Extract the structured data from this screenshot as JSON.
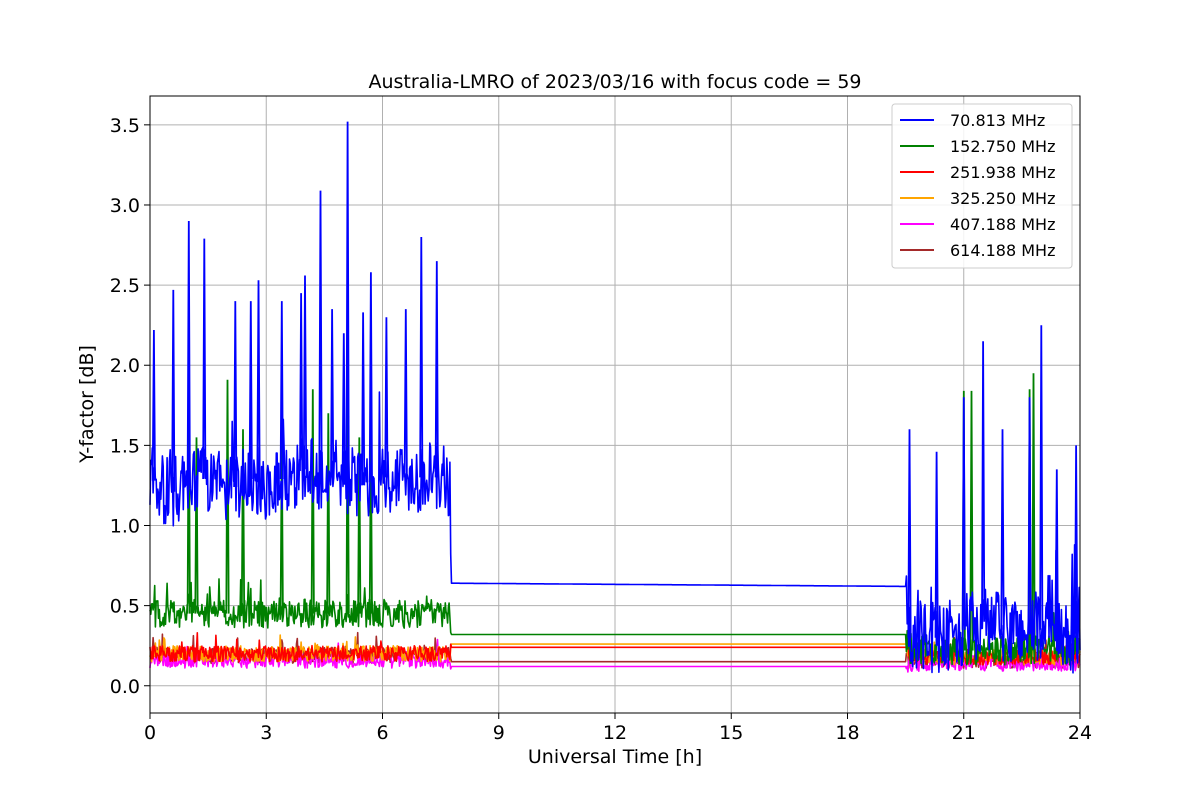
{
  "chart_data": {
    "type": "line",
    "title": "Australia-LMRO of 2023/03/16 with focus code = 59",
    "xlabel": "Universal Time [h]",
    "ylabel": "Y-factor [dB]",
    "xlim": [
      0,
      24
    ],
    "ylim": [
      -0.17,
      3.68
    ],
    "xticks": [
      0,
      3,
      6,
      9,
      12,
      15,
      18,
      21,
      24
    ],
    "yticks": [
      0.0,
      0.5,
      1.0,
      1.5,
      2.0,
      2.5,
      3.0,
      3.5
    ],
    "xtick_labels": [
      "0",
      "3",
      "6",
      "9",
      "12",
      "15",
      "18",
      "21",
      "24"
    ],
    "ytick_labels": [
      "0.0",
      "0.5",
      "1.0",
      "1.5",
      "2.0",
      "2.5",
      "3.0",
      "3.5"
    ],
    "grid": true,
    "legend": "top-right",
    "series": [
      {
        "name": " 70.813 MHz",
        "color": "#0000ff",
        "x": [
          0,
          0.5,
          1.0,
          1.5,
          2.0,
          2.5,
          3.0,
          3.5,
          4.0,
          4.5,
          5.0,
          5.5,
          6.0,
          6.5,
          7.0,
          7.5,
          7.75,
          7.76,
          19.5,
          19.6,
          20.0,
          20.5,
          21.0,
          21.5,
          22.0,
          22.5,
          23.0,
          23.5,
          24.0
        ],
        "y": [
          1.3,
          1.2,
          1.25,
          1.3,
          1.2,
          1.3,
          1.25,
          1.3,
          1.35,
          1.3,
          1.3,
          1.25,
          1.3,
          1.3,
          1.3,
          1.3,
          1.25,
          0.64,
          0.62,
          0.3,
          0.3,
          0.3,
          0.35,
          0.4,
          0.35,
          0.35,
          0.35,
          0.3,
          0.3
        ],
        "peaks": [
          [
            0.1,
            2.22
          ],
          [
            0.6,
            2.47
          ],
          [
            1.0,
            2.9
          ],
          [
            1.4,
            2.79
          ],
          [
            2.2,
            2.4
          ],
          [
            2.6,
            2.4
          ],
          [
            2.8,
            2.53
          ],
          [
            3.4,
            2.4
          ],
          [
            3.9,
            2.45
          ],
          [
            4.0,
            2.56
          ],
          [
            4.4,
            3.09
          ],
          [
            4.7,
            2.35
          ],
          [
            5.0,
            2.2
          ],
          [
            5.1,
            3.52
          ],
          [
            5.5,
            2.33
          ],
          [
            5.7,
            2.58
          ],
          [
            6.1,
            2.3
          ],
          [
            6.6,
            2.35
          ],
          [
            7.0,
            2.8
          ],
          [
            7.4,
            2.65
          ],
          [
            19.6,
            1.6
          ],
          [
            20.3,
            1.46
          ],
          [
            21.0,
            1.8
          ],
          [
            21.5,
            2.15
          ],
          [
            22.0,
            1.6
          ],
          [
            22.7,
            1.8
          ],
          [
            23.0,
            2.25
          ],
          [
            23.4,
            1.35
          ],
          [
            23.9,
            1.5
          ]
        ],
        "noise": 0.22
      },
      {
        "name": "152.750 MHz",
        "color": "#008000",
        "x": [
          0,
          1,
          2,
          3,
          4,
          5,
          6,
          7,
          7.75,
          7.76,
          19.5,
          19.6,
          20.5,
          21.5,
          22.5,
          23.5,
          24.0
        ],
        "y": [
          0.45,
          0.45,
          0.45,
          0.45,
          0.45,
          0.45,
          0.45,
          0.45,
          0.45,
          0.32,
          0.32,
          0.22,
          0.22,
          0.22,
          0.22,
          0.22,
          0.22
        ],
        "peaks": [
          [
            1.0,
            1.94
          ],
          [
            1.2,
            1.55
          ],
          [
            2.0,
            1.91
          ],
          [
            2.4,
            1.6
          ],
          [
            3.4,
            1.55
          ],
          [
            4.2,
            1.85
          ],
          [
            4.6,
            1.7
          ],
          [
            5.1,
            1.95
          ],
          [
            5.4,
            1.55
          ],
          [
            5.7,
            1.55
          ],
          [
            21.0,
            1.84
          ],
          [
            21.2,
            1.84
          ],
          [
            22.7,
            1.85
          ],
          [
            22.8,
            1.95
          ]
        ],
        "noise": 0.09
      },
      {
        "name": "251.938 MHz",
        "color": "#ff0000",
        "x": [
          0,
          2,
          4,
          6,
          7.75,
          7.76,
          19.5,
          19.6,
          21,
          22.5,
          24.0
        ],
        "y": [
          0.2,
          0.2,
          0.2,
          0.2,
          0.2,
          0.24,
          0.24,
          0.18,
          0.18,
          0.18,
          0.18
        ],
        "peaks": [],
        "noise": 0.05
      },
      {
        "name": "325.250 MHz",
        "color": "#ffa500",
        "x": [
          0,
          2,
          4,
          6,
          7.75,
          7.76,
          19.5,
          19.6,
          21,
          22.5,
          24.0
        ],
        "y": [
          0.2,
          0.2,
          0.2,
          0.2,
          0.2,
          0.26,
          0.26,
          0.18,
          0.18,
          0.18,
          0.18
        ],
        "peaks": [],
        "noise": 0.05
      },
      {
        "name": "407.188 MHz",
        "color": "#ff00ff",
        "x": [
          0,
          2,
          4,
          6,
          7.75,
          7.76,
          19.5,
          19.6,
          21,
          22.5,
          24.0
        ],
        "y": [
          0.16,
          0.16,
          0.16,
          0.16,
          0.16,
          0.12,
          0.12,
          0.14,
          0.14,
          0.14,
          0.14
        ],
        "peaks": [],
        "noise": 0.05
      },
      {
        "name": "614.188 MHz",
        "color": "#a52a2a",
        "x": [
          0,
          2,
          4,
          6,
          7.75,
          7.76,
          19.5,
          19.6,
          21,
          22.5,
          24.0
        ],
        "y": [
          0.19,
          0.19,
          0.19,
          0.19,
          0.19,
          0.15,
          0.15,
          0.16,
          0.16,
          0.16,
          0.16
        ],
        "peaks": [],
        "noise": 0.05
      }
    ]
  }
}
